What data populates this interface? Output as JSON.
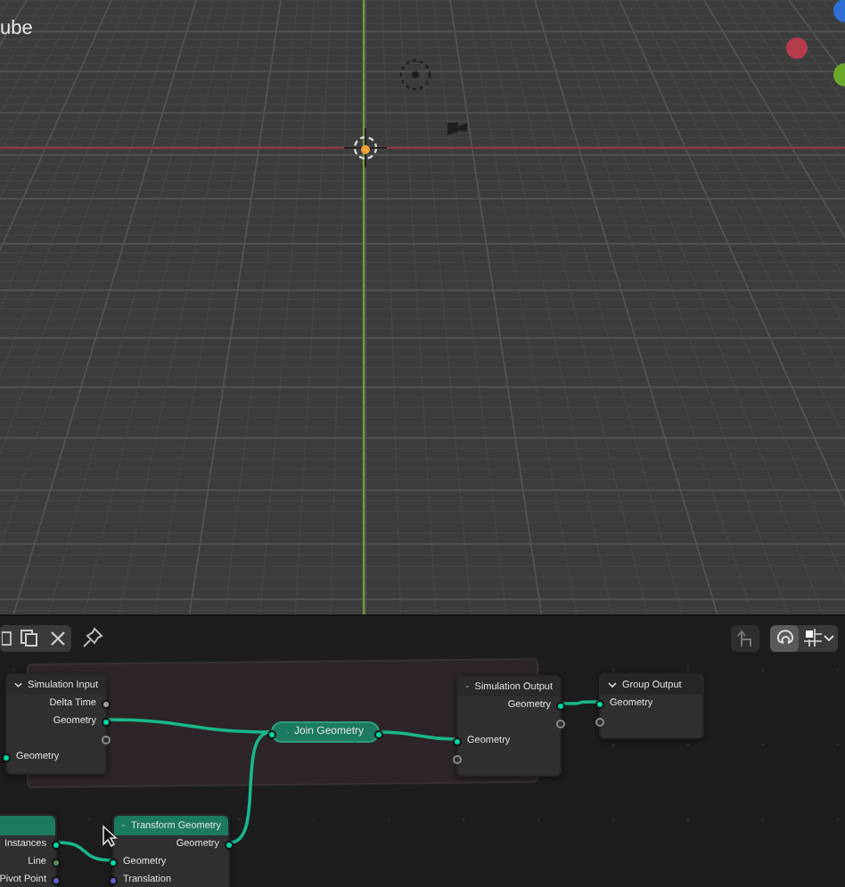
{
  "viewport": {
    "object_name": "ube"
  },
  "node_editor": {
    "snapping": {
      "on": true
    },
    "nodes": [
      {
        "title": "Simulation Input",
        "collapsed": false,
        "color": "#2a2a2a",
        "outputs": [
          {
            "kind": "socket",
            "label": "Delta Time",
            "color": "#a1a1a1"
          },
          {
            "kind": "socket",
            "label": "Geometry",
            "color": "#00d6a3"
          },
          {
            "kind": "empty"
          }
        ],
        "inputs": [
          {
            "kind": "socket",
            "label": "Geometry",
            "color": "#00d6a3"
          }
        ]
      },
      {
        "title": "Join Geometry",
        "collapsed": true,
        "color": "#1c7a60"
      },
      {
        "title": "Simulation Output",
        "collapsed": false,
        "color": "#2a2a2a",
        "outputs": [
          {
            "kind": "socket",
            "label": "Geometry",
            "color": "#00d6a3"
          },
          {
            "kind": "empty"
          }
        ],
        "inputs": [
          {
            "kind": "socket",
            "label": "Geometry",
            "color": "#00d6a3"
          },
          {
            "kind": "empty"
          }
        ]
      },
      {
        "title": "Group Output",
        "collapsed": false,
        "color": "#262626",
        "inputs": [
          {
            "kind": "socket",
            "label": "Geometry",
            "color": "#00d6a3"
          },
          {
            "kind": "empty"
          }
        ]
      },
      {
        "collapsed": false,
        "color": "#1c7a60",
        "outputs": [
          {
            "kind": "socket",
            "label": "Instances",
            "color": "#00d6a3"
          },
          {
            "kind": "socket",
            "label": "Line",
            "color": "#598c5c"
          },
          {
            "kind": "socket",
            "label": "Pivot Point",
            "color": "#6363c7"
          }
        ]
      },
      {
        "title": "Transform Geometry",
        "collapsed": false,
        "color": "#1c7a60",
        "outputs": [
          {
            "kind": "socket",
            "label": "Geometry",
            "color": "#00d6a3"
          }
        ],
        "inputs": [
          {
            "kind": "socket",
            "label": "Geometry",
            "color": "#00d6a3"
          },
          {
            "kind": "socket",
            "label": "Translation",
            "color": "#6363c7"
          }
        ]
      }
    ]
  }
}
